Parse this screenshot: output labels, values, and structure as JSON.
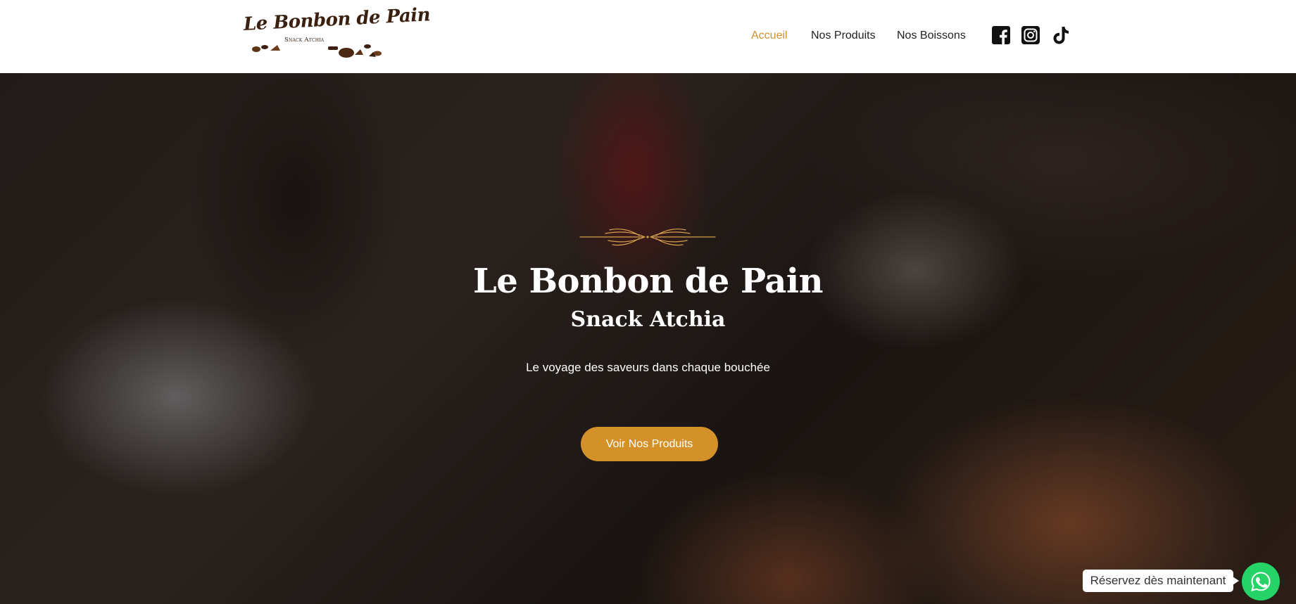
{
  "header": {
    "logo": {
      "name": "Le Bonbon de Pain",
      "subtitle": "Snack Atchia"
    },
    "nav": [
      {
        "label": "Accueil",
        "active": true
      },
      {
        "label": "Nos Produits",
        "active": false
      },
      {
        "label": "Nos Boissons",
        "active": false
      }
    ],
    "social": [
      {
        "icon": "facebook-icon"
      },
      {
        "icon": "instagram-icon"
      },
      {
        "icon": "tiktok-icon"
      }
    ]
  },
  "hero": {
    "title": "Le Bonbon de Pain",
    "subtitle": "Snack Atchia",
    "tagline": "Le voyage des saveurs dans chaque bouchée",
    "cta_label": "Voir Nos Produits",
    "ornament_icon": "wheat-ornament-icon"
  },
  "whatsapp": {
    "label": "Réservez dès maintenant",
    "icon": "whatsapp-icon"
  },
  "colors": {
    "accent": "#d4912a",
    "header_bg": "#ffffff",
    "whatsapp_green": "#25d366",
    "logo_brown": "#3b2010"
  }
}
